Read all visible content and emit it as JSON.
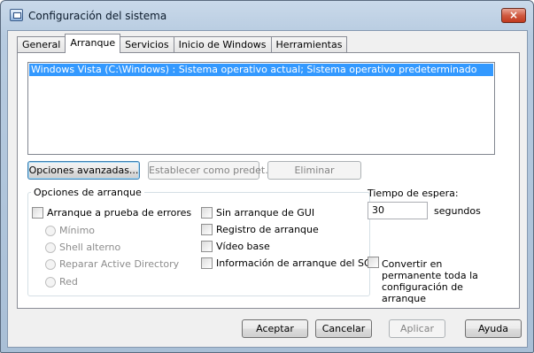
{
  "window": {
    "title": "Configuración del sistema",
    "close_glyph": "×",
    "icon": "system-config-icon"
  },
  "tabs": [
    {
      "label": "General"
    },
    {
      "label": "Arranque"
    },
    {
      "label": "Servicios"
    },
    {
      "label": "Inicio de Windows"
    },
    {
      "label": "Herramientas"
    }
  ],
  "boot_list": {
    "items": [
      {
        "label": "Windows Vista (C:\\Windows) : Sistema operativo actual; Sistema operativo predeterminado",
        "selected": true
      }
    ]
  },
  "list_buttons": {
    "advanced": "Opciones avanzadas...",
    "set_default": "Establecer como predet.",
    "delete": "Eliminar"
  },
  "boot_options": {
    "legend": "Opciones de arranque",
    "safe_boot": "Arranque a prueba de errores",
    "radios": [
      "Mínimo",
      "Shell alterno",
      "Reparar Active Directory",
      "Red"
    ],
    "no_gui": "Sin arranque de GUI",
    "boot_log": "Registro de arranque",
    "base_video": "Vídeo base",
    "os_boot_info": "Información de arranque del SO"
  },
  "timeout": {
    "label": "Tiempo de espera:",
    "value": "30",
    "unit": "segundos"
  },
  "persist": {
    "label": "Convertir en permanente toda la configuración de arranque"
  },
  "footer": {
    "ok": "Aceptar",
    "cancel": "Cancelar",
    "apply": "Aplicar",
    "help": "Ayuda"
  },
  "colors": {
    "selection": "#3399ff",
    "close_button": "#c13a1f"
  }
}
